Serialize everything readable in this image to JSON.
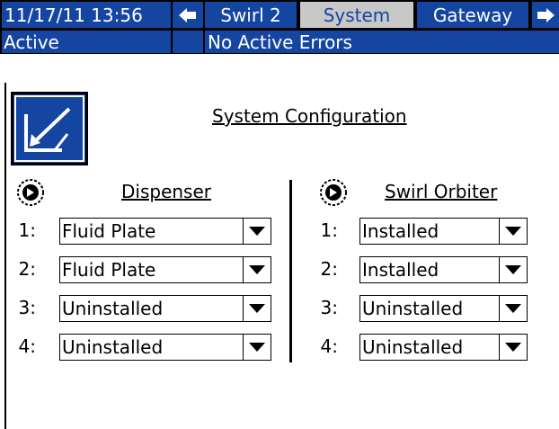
{
  "header": {
    "datetime": "11/17/11 13:56",
    "tabs": [
      {
        "label": "Swirl 2",
        "active": false
      },
      {
        "label": "System",
        "active": true
      },
      {
        "label": "Gateway",
        "active": false
      }
    ],
    "status": "Active",
    "errors": "No Active Errors"
  },
  "page": {
    "title": "System Configuration"
  },
  "dispenser": {
    "title": "Dispenser",
    "rows": [
      {
        "num": "1:",
        "value": "Fluid Plate"
      },
      {
        "num": "2:",
        "value": "Fluid Plate"
      },
      {
        "num": "3:",
        "value": "Uninstalled"
      },
      {
        "num": "4:",
        "value": "Uninstalled"
      }
    ]
  },
  "orbiter": {
    "title": "Swirl Orbiter",
    "rows": [
      {
        "num": "1:",
        "value": "Installed"
      },
      {
        "num": "2:",
        "value": "Installed"
      },
      {
        "num": "3:",
        "value": "Uninstalled"
      },
      {
        "num": "4:",
        "value": "Uninstalled"
      }
    ]
  },
  "icons": [
    "arrow-left-icon",
    "arrow-right-icon",
    "edit-config-icon",
    "knob-icon",
    "dropdown-arrow-icon"
  ],
  "colors": {
    "accent": "#1445a0",
    "active_tab": "#c8c8c8"
  }
}
